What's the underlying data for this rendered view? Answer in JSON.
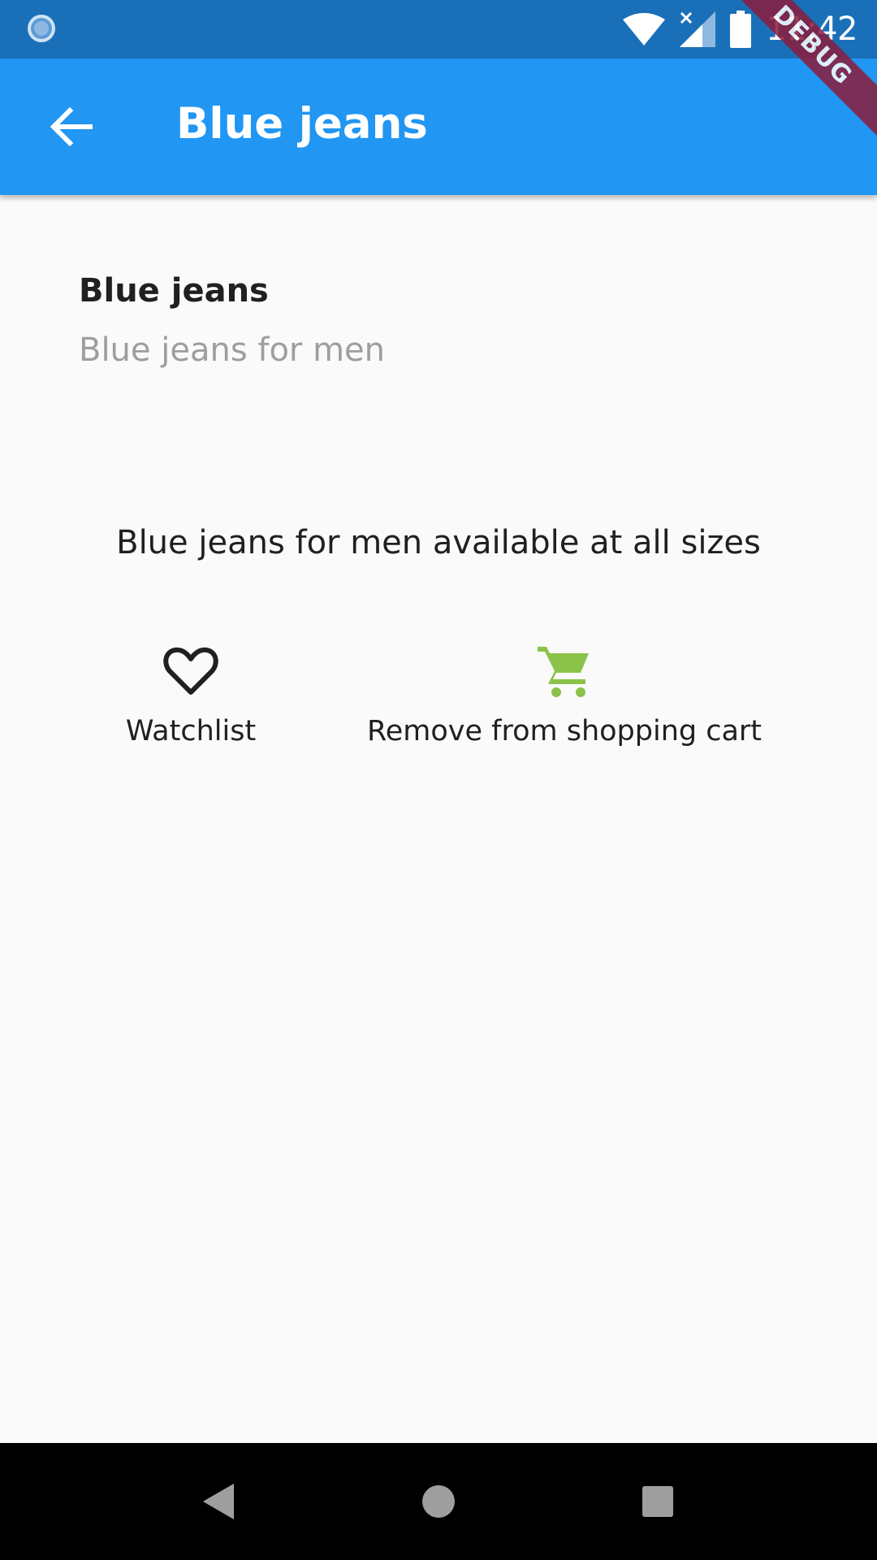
{
  "status_bar": {
    "time": "11:42",
    "debug_label": "DEBUG"
  },
  "app_bar": {
    "title": "Blue jeans",
    "back_icon": "arrow-back-icon"
  },
  "product": {
    "title": "Blue jeans",
    "subtitle": "Blue jeans for men",
    "description": "Blue jeans for men available at all sizes"
  },
  "actions": {
    "watchlist": {
      "label": "Watchlist",
      "icon": "heart-outline-icon"
    },
    "cart": {
      "label": "Remove from shopping cart",
      "icon": "shopping-cart-icon",
      "color": "#8bc34a"
    }
  },
  "colors": {
    "status_bar": "#1a70b8",
    "app_bar": "#2196f3",
    "background": "#fafafa",
    "subtitle": "#9e9e9e"
  },
  "nav_bar": {
    "buttons": [
      "back-triangle-icon",
      "home-circle-icon",
      "recents-square-icon"
    ]
  }
}
